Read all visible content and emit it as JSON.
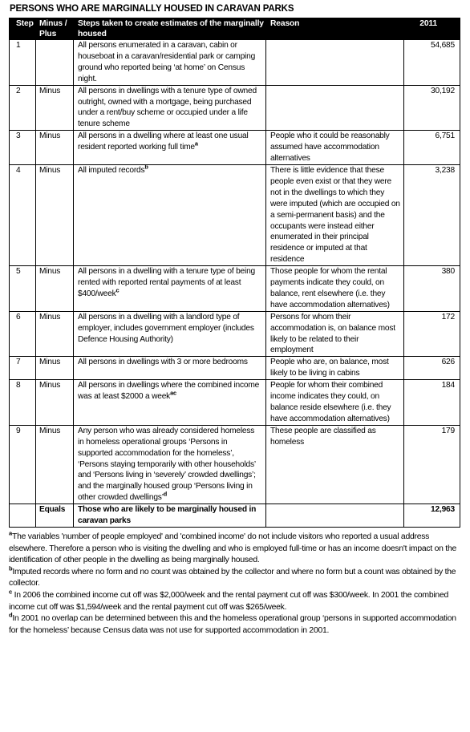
{
  "document": {
    "title": "PERSONS WHO ARE MARGINALLY HOUSED IN CARAVAN PARKS"
  },
  "table": {
    "headers": {
      "step": "Step",
      "sign": "Minus / Plus",
      "steps_taken": "Steps taken to create estimates of the marginally housed",
      "reason": "Reason",
      "year": "2011"
    },
    "rows": [
      {
        "step": "1",
        "sign": "",
        "steps_taken": "All persons enumerated in a caravan, cabin or houseboat in a caravan/residential park or camping ground who reported being ‘at home’ on Census night.",
        "steps_sup": "",
        "reason": "",
        "year": "54,685"
      },
      {
        "step": "2",
        "sign": "Minus",
        "steps_taken": "All persons in dwellings with a tenure type of owned outright, owned with a mortgage, being purchased under a rent/buy scheme or occupied under a life tenure scheme",
        "steps_sup": "",
        "reason": "",
        "year": "30,192"
      },
      {
        "step": "3",
        "sign": "Minus",
        "steps_taken": "All persons in a dwelling where at least one usual resident reported working full time",
        "steps_sup": "a",
        "reason": "People who it could be reasonably assumed have accommodation alternatives",
        "year": "6,751"
      },
      {
        "step": "4",
        "sign": "Minus",
        "steps_taken": "All imputed records",
        "steps_sup": "b",
        "reason": "There is little evidence that these people even exist or that they were not in the dwellings to which they were imputed (which are occupied on a semi-permanent basis) and the occupants were instead either enumerated in their principal residence or imputed at that residence",
        "year": "3,238"
      },
      {
        "step": "5",
        "sign": "Minus",
        "steps_taken": "All persons in a dwelling with a tenure type of being rented with reported rental payments of at least $400/week",
        "steps_sup": "c",
        "reason": "Those people for whom the rental payments indicate they could, on balance, rent elsewhere (i.e. they have accommodation alternatives)",
        "year": "380"
      },
      {
        "step": "6",
        "sign": "Minus",
        "steps_taken": "All persons in a dwelling with a landlord type of employer, includes government employer (includes Defence Housing Authority)",
        "steps_sup": "",
        "reason": "Persons for whom their accommodation is, on balance most likely to be related to their employment",
        "year": "172"
      },
      {
        "step": "7",
        "sign": "Minus",
        "steps_taken": "All persons in dwellings with 3 or more bedrooms",
        "steps_sup": "",
        "reason": "People who are, on balance, most likely to be living in cabins",
        "year": "626"
      },
      {
        "step": "8",
        "sign": "Minus",
        "steps_taken": "All persons in dwellings where the combined income was at least $2000 a week",
        "steps_sup": "ac",
        "reason": "People for whom their combined income indicates they could, on balance reside elsewhere (i.e. they have accommodation alternatives)",
        "year": "184"
      },
      {
        "step": "9",
        "sign": "Minus",
        "steps_taken": "Any person who was already considered homeless in homeless operational groups ‘Persons in supported accommodation for the homeless’, ‘Persons staying temporarily with other households’ and ‘Persons living in ‘severely’ crowded dwellings’; and the marginally housed group ‘Persons living in other crowded dwellings’",
        "steps_sup": "d",
        "reason": "These people are classified as homeless",
        "year": "179"
      },
      {
        "step": "",
        "sign": "Equals",
        "steps_taken": "Those who are likely to be marginally housed in caravan parks",
        "steps_sup": "",
        "reason": "",
        "year": "12,963"
      }
    ]
  },
  "footnotes": [
    {
      "marker": "a",
      "text": "The variables 'number of people employed' and 'combined income' do not include visitors who reported a usual address elsewhere. Therefore a person who is visiting the dwelling and who is employed full-time or has an income doesn't impact on the identification of other people in the dwelling as being marginally housed."
    },
    {
      "marker": "b",
      "text": "Imputed records where no form and no count was obtained by the collector and where no form but a count was obtained by the collector."
    },
    {
      "marker": "c",
      "text": " In 2006 the combined income cut off was $2,000/week and the rental payment cut off was $300/week. In 2001 the combined income cut off was $1,594/week and the rental payment cut off was $265/week."
    },
    {
      "marker": "d",
      "text": "In 2001 no overlap can be determined between this and the homeless operational group ‘persons in supported accommodation for the homeless’ because Census data was not use for supported accommodation in 2001."
    }
  ]
}
